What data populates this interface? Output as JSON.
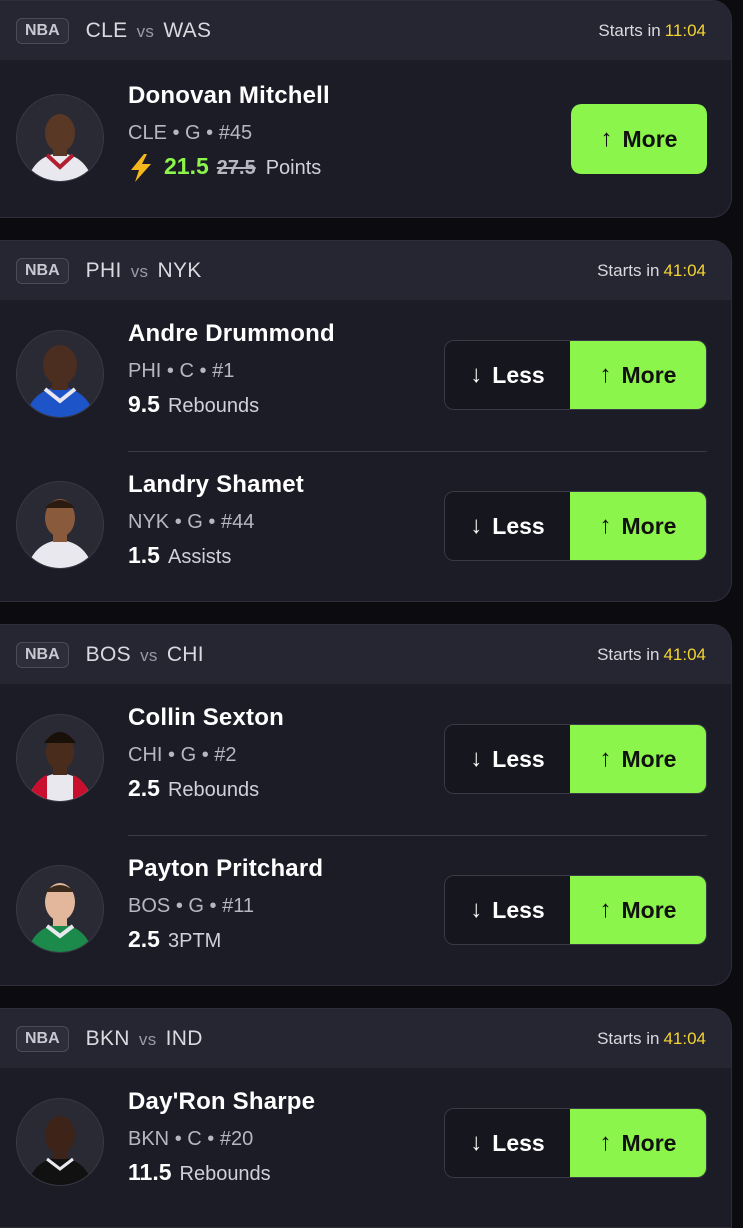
{
  "games": [
    {
      "league": "NBA",
      "team_a": "CLE",
      "vs": "vs",
      "team_b": "WAS",
      "starts_label": "Starts in",
      "starts_time": "11:04",
      "players": [
        {
          "name": "Donovan Mitchell",
          "team": "CLE",
          "pos": "G",
          "number": "#45",
          "line": "21.5",
          "original_line": "27.5",
          "stat": "Points",
          "boosted": true,
          "less_label": "",
          "more_label": "More"
        }
      ]
    },
    {
      "league": "NBA",
      "team_a": "PHI",
      "vs": "vs",
      "team_b": "NYK",
      "starts_label": "Starts in",
      "starts_time": "41:04",
      "players": [
        {
          "name": "Andre Drummond",
          "team": "PHI",
          "pos": "C",
          "number": "#1",
          "line": "9.5",
          "stat": "Rebounds",
          "less_label": "Less",
          "more_label": "More"
        },
        {
          "name": "Landry Shamet",
          "team": "NYK",
          "pos": "G",
          "number": "#44",
          "line": "1.5",
          "stat": "Assists",
          "less_label": "Less",
          "more_label": "More"
        }
      ]
    },
    {
      "league": "NBA",
      "team_a": "BOS",
      "vs": "vs",
      "team_b": "CHI",
      "starts_label": "Starts in",
      "starts_time": "41:04",
      "players": [
        {
          "name": "Collin Sexton",
          "team": "CHI",
          "pos": "G",
          "number": "#2",
          "line": "2.5",
          "stat": "Rebounds",
          "less_label": "Less",
          "more_label": "More"
        },
        {
          "name": "Payton Pritchard",
          "team": "BOS",
          "pos": "G",
          "number": "#11",
          "line": "2.5",
          "stat": "3PTM",
          "less_label": "Less",
          "more_label": "More"
        }
      ]
    },
    {
      "league": "NBA",
      "team_a": "BKN",
      "vs": "vs",
      "team_b": "IND",
      "starts_label": "Starts in",
      "starts_time": "41:04",
      "players": [
        {
          "name": "Day'Ron Sharpe",
          "team": "BKN",
          "pos": "C",
          "number": "#20",
          "line": "11.5",
          "stat": "Rebounds",
          "less_label": "Less",
          "more_label": "More"
        }
      ]
    }
  ],
  "separator": "•",
  "colors": {
    "accent": "#8cf54b",
    "time": "#f4d430",
    "card": "#1c1c27",
    "header": "#262632",
    "bg": "#0b0b10"
  },
  "icons": {
    "boost": "lightning-bolt-icon",
    "up": "arrow-up-icon",
    "down": "arrow-down-icon"
  }
}
